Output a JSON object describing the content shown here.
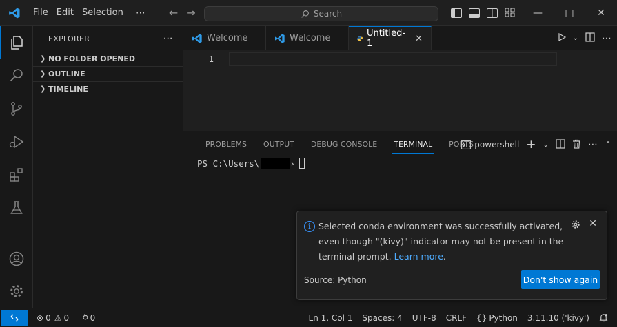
{
  "colors": {
    "accent": "#0078d4",
    "link": "#4daafc",
    "info": "#3794ff"
  },
  "titlebar": {
    "menu": [
      "File",
      "Edit",
      "Selection"
    ],
    "more": "⋯",
    "search_placeholder": "Search"
  },
  "sidebar": {
    "title": "EXPLORER",
    "more": "⋯",
    "sections": [
      "NO FOLDER OPENED",
      "OUTLINE",
      "TIMELINE"
    ]
  },
  "tabs": [
    {
      "label": "Welcome",
      "icon": "vscode-icon",
      "active": false
    },
    {
      "label": "Welcome",
      "icon": "vscode-icon",
      "active": false
    },
    {
      "label": "Untitled-1",
      "icon": "python-icon",
      "active": true
    }
  ],
  "editor": {
    "line_number": "1"
  },
  "panel": {
    "tabs": [
      "PROBLEMS",
      "OUTPUT",
      "DEBUG CONSOLE",
      "TERMINAL",
      "PORTS"
    ],
    "active_tab": "TERMINAL",
    "terminal_name": "powershell",
    "prompt_prefix": "PS C:\\Users\\",
    "prompt_suffix": "›"
  },
  "notification": {
    "message": "Selected conda environment was successfully activated, even though \"(kivy)\" indicator may not be present in the terminal prompt.",
    "link": "Learn more",
    "source": "Source: Python",
    "button": "Don't show again"
  },
  "statusbar": {
    "errors": "0",
    "warnings": "0",
    "ports": "0",
    "position": "Ln 1, Col 1",
    "spaces": "Spaces: 4",
    "encoding": "UTF-8",
    "eol": "CRLF",
    "language": "Python",
    "interpreter": "3.11.10 ('kivy')"
  }
}
